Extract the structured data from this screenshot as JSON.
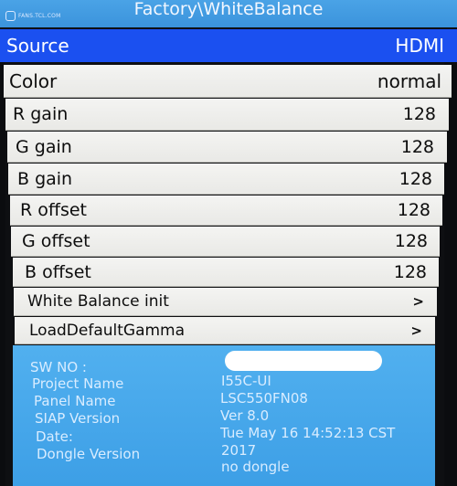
{
  "watermark": "FANS.TCL.COM",
  "title": "Factory\\WhiteBalance",
  "source": {
    "label": "Source",
    "value": "HDMI"
  },
  "rows": [
    {
      "label": "Color",
      "value": "normal"
    },
    {
      "label": "R gain",
      "value": "128"
    },
    {
      "label": "G gain",
      "value": "128"
    },
    {
      "label": "B gain",
      "value": "128"
    },
    {
      "label": "R offset",
      "value": "128"
    },
    {
      "label": "G offset",
      "value": "128"
    },
    {
      "label": "B offset",
      "value": "128"
    },
    {
      "label": "White Balance init",
      "value": ">"
    },
    {
      "label": "LoadDefaultGamma",
      "value": ">"
    }
  ],
  "info": {
    "sw_no_label": "SW NO :",
    "project_name_label": "Project Name",
    "project_name_value": "I55C-UI",
    "panel_name_label": "Panel Name",
    "panel_name_value": "LSC550FN08",
    "siap_version_label": "SIAP Version",
    "siap_version_value": "Ver 8.0",
    "date_label": "Date:",
    "date_value_line1": "Tue May 16 14:52:13 CST",
    "date_value_line2": "2017",
    "dongle_version_label": "Dongle Version",
    "dongle_version_value": "no dongle"
  },
  "colors": {
    "title_bar": "#3b93dc",
    "selected_row": "#1b50f0",
    "menu_row": "#f0f0ee",
    "info_panel": "#45a6ea"
  }
}
